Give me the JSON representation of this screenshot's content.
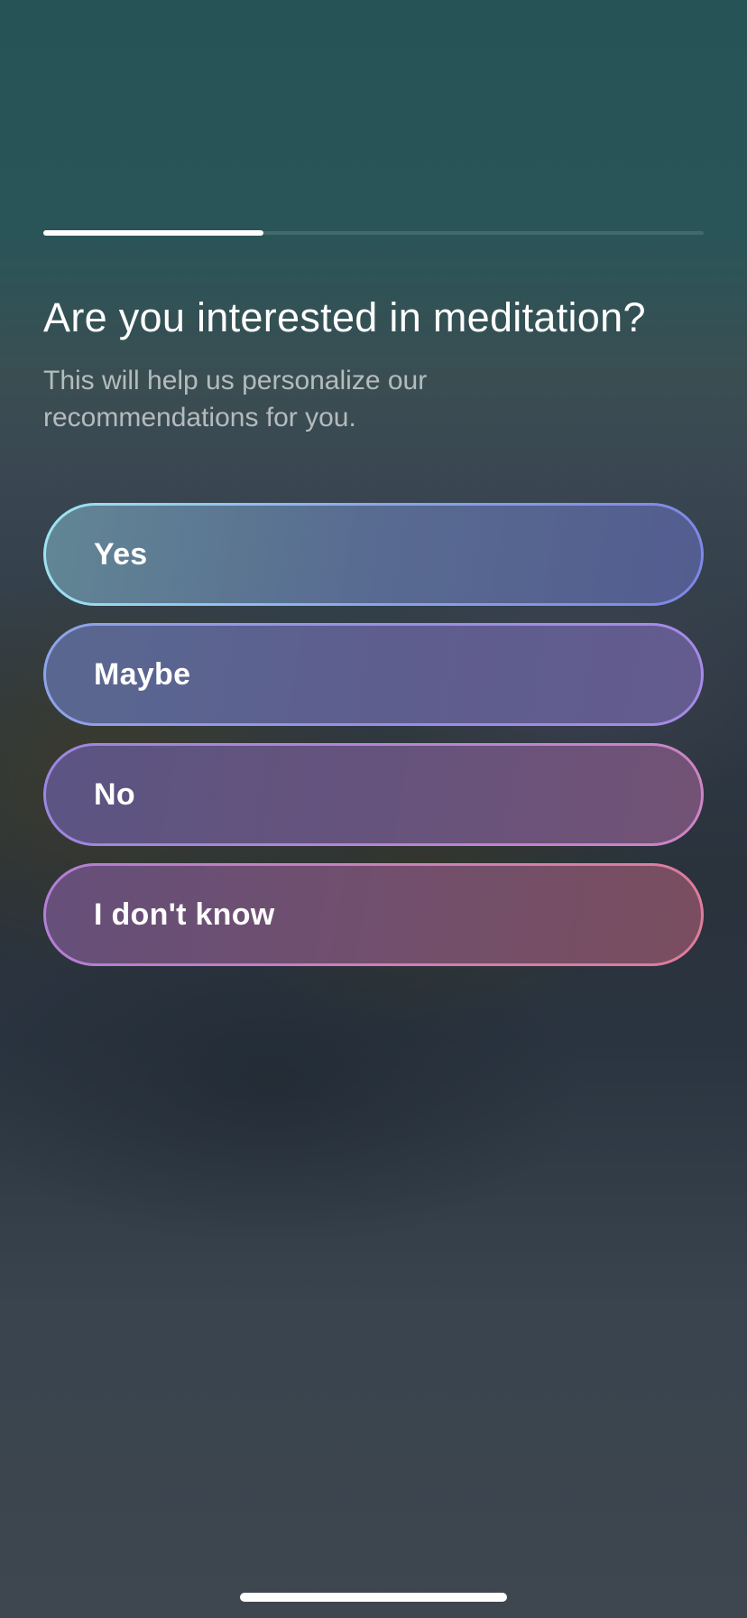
{
  "progress": {
    "value": 0.333
  },
  "question": {
    "title": "Are you interested in meditation?",
    "subtitle": "This will help us personalize our recommendations for you."
  },
  "options": [
    {
      "label": "Yes"
    },
    {
      "label": "Maybe"
    },
    {
      "label": "No"
    },
    {
      "label": "I don't know"
    }
  ],
  "colors": {
    "background_top": "#265356",
    "background_bottom": "#3e464f",
    "text": "#ffffff",
    "border_start": "#9fe4f2",
    "border_mid": "#a78ae8",
    "border_end": "#e07c9a"
  }
}
